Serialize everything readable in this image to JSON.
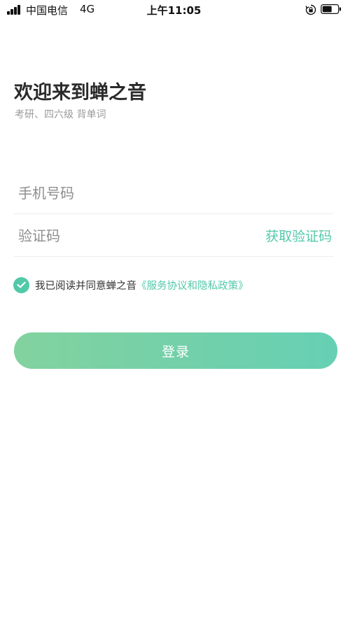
{
  "status_bar": {
    "carrier": "中国电信",
    "network": "4G",
    "time": "上午11:05",
    "icons": [
      "signal-icon",
      "orientation-lock-icon",
      "battery-icon"
    ]
  },
  "header": {
    "title": "欢迎来到蝉之音",
    "subtitle": "考研、四六级 背单词"
  },
  "form": {
    "phone_placeholder": "手机号码",
    "phone_value": "",
    "code_placeholder": "验证码",
    "code_value": "",
    "get_code_label": "获取验证码"
  },
  "agreement": {
    "checked": true,
    "text": "我已阅读并同意蝉之音",
    "link": "《服务协议和隐私政策》"
  },
  "login_label": "登录",
  "colors": {
    "accent": "#52c9a8",
    "button_gradient_start": "#7cd09a",
    "button_gradient_end": "#5ecdb0",
    "title": "#2b2b2b",
    "subtitle": "#9a9a9a"
  }
}
